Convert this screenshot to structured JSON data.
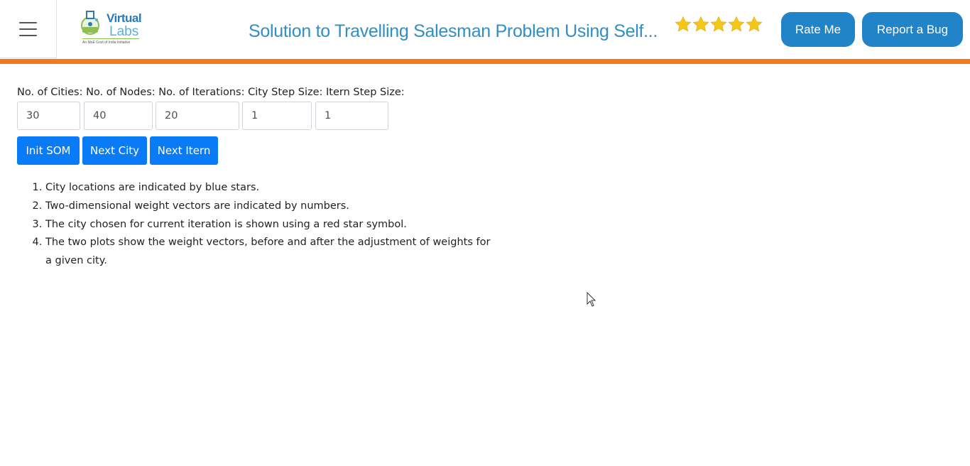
{
  "header": {
    "logo": {
      "word1": "Virtual",
      "word2": "Labs",
      "tagline": "An MoE Govt of India Initiative"
    },
    "title": "Solution to Travelling Salesman Problem Using Self...",
    "rating_stars": 5,
    "rate_button": "Rate Me",
    "bug_button": "Report a Bug"
  },
  "form": {
    "labels": {
      "cities": "No. of Cities:",
      "nodes": "No. of Nodes:",
      "iterations": "No. of Iterations:",
      "city_step": "City Step Size:",
      "itern_step": "Itern Step Size:"
    },
    "values": {
      "cities": "30",
      "nodes": "40",
      "iterations": "20",
      "city_step": "1",
      "itern_step": "1"
    },
    "buttons": {
      "init": "Init SOM",
      "next_city": "Next City",
      "next_itern": "Next Itern"
    }
  },
  "instructions": [
    "City locations are indicated by blue stars.",
    "Two-dimensional weight vectors are indicated by numbers.",
    "The city chosen for current iteration is shown using a red star symbol.",
    "The two plots show the weight vectors, before and after the adjustment of weights for a given city."
  ],
  "colors": {
    "accent_orange": "#f4781e",
    "header_button": "#2184c9",
    "primary_button": "#0a7bf6",
    "title_blue": "#2f8fc6",
    "star_gold": "#f5c518"
  }
}
